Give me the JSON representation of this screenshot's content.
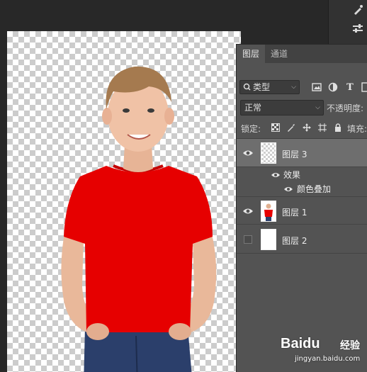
{
  "panel": {
    "tabs": [
      {
        "label": "图层"
      },
      {
        "label": "通道"
      }
    ],
    "filter": {
      "kind_label": "类型"
    },
    "blend": {
      "mode": "正常",
      "opacity_label": "不透明度:"
    },
    "lock": {
      "label": "锁定:",
      "fill_label": "填充:"
    },
    "layers": [
      {
        "name": "图层 3",
        "visible": true,
        "selected": true,
        "fx": "fx"
      },
      {
        "name": "图层 1",
        "visible": true,
        "selected": false
      },
      {
        "name": "图层 2",
        "visible": false,
        "selected": false
      }
    ],
    "effects": {
      "group_label": "效果",
      "items": [
        {
          "label": "颜色叠加"
        }
      ]
    }
  },
  "watermark": {
    "brand": "Baidu",
    "suffix": "经验",
    "url": "jingyan.baidu.com"
  },
  "colors": {
    "shirt": "#e60000",
    "panel_bg": "#535353",
    "app_bg": "#282828"
  }
}
